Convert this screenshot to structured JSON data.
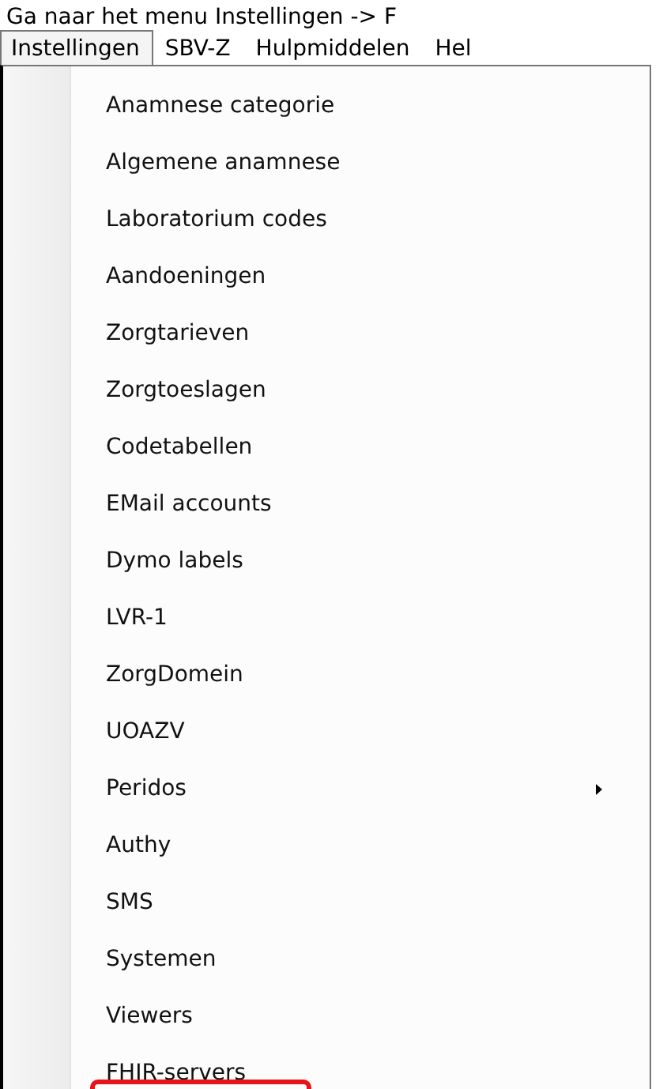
{
  "caption": "Ga naar het menu Instellingen -> F",
  "menu_bar": [
    {
      "label": "Instellingen",
      "selected": true
    },
    {
      "label": "SBV-Z",
      "selected": false
    },
    {
      "label": "Hulpmiddelen",
      "selected": false
    },
    {
      "label": "Hel",
      "selected": false
    }
  ],
  "dropdown": {
    "items": [
      {
        "label": "Anamnese categorie",
        "submenu": false
      },
      {
        "label": "Algemene anamnese",
        "submenu": false
      },
      {
        "label": "Laboratorium codes",
        "submenu": false
      },
      {
        "label": "Aandoeningen",
        "submenu": false
      },
      {
        "label": "Zorgtarieven",
        "submenu": false
      },
      {
        "label": "Zorgtoeslagen",
        "submenu": false
      },
      {
        "label": "Codetabellen",
        "submenu": false
      },
      {
        "label": "EMail accounts",
        "submenu": false
      },
      {
        "label": "Dymo labels",
        "submenu": false
      },
      {
        "label": "LVR-1",
        "submenu": false
      },
      {
        "label": "ZorgDomein",
        "submenu": false
      },
      {
        "label": "UOAZV",
        "submenu": false
      },
      {
        "label": "Peridos",
        "submenu": true
      },
      {
        "label": "Authy",
        "submenu": false
      },
      {
        "label": "SMS",
        "submenu": false
      },
      {
        "label": "Systemen",
        "submenu": false
      },
      {
        "label": "Viewers",
        "submenu": false
      },
      {
        "label": "FHIR-servers",
        "submenu": false
      }
    ]
  }
}
